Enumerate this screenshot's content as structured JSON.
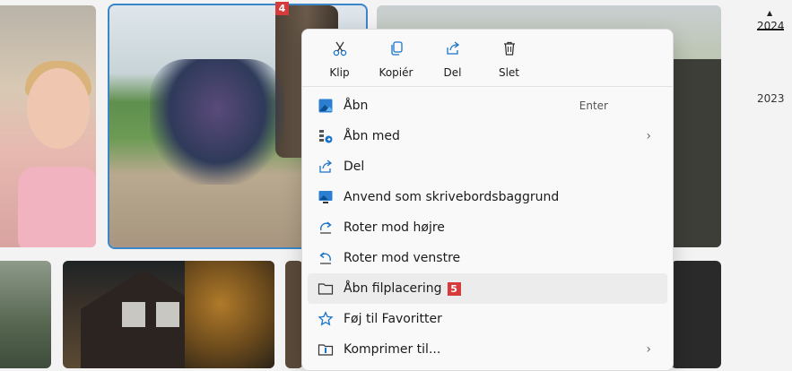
{
  "badges": {
    "photo": "4",
    "menu_item": "5"
  },
  "timeline": {
    "years": [
      "2024",
      "2023"
    ]
  },
  "quick_actions": [
    {
      "label": "Klip",
      "icon": "scissors-icon"
    },
    {
      "label": "Kopiér",
      "icon": "copy-icon"
    },
    {
      "label": "Del",
      "icon": "share-icon"
    },
    {
      "label": "Slet",
      "icon": "trash-icon"
    }
  ],
  "menu_items": [
    {
      "label": "Åbn",
      "icon": "photo-icon",
      "shortcut": "Enter"
    },
    {
      "label": "Åbn med",
      "icon": "open-with-icon",
      "submenu": "›"
    },
    {
      "label": "Del",
      "icon": "share-icon"
    },
    {
      "label": "Anvend som skrivebordsbaggrund",
      "icon": "wallpaper-icon"
    },
    {
      "label": "Roter mod højre",
      "icon": "rotate-right-icon"
    },
    {
      "label": "Roter mod venstre",
      "icon": "rotate-left-icon"
    },
    {
      "label": "Åbn filplacering",
      "icon": "folder-icon",
      "highlighted": true
    },
    {
      "label": "Føj til Favoritter",
      "icon": "star-icon"
    },
    {
      "label": "Komprimer til...",
      "icon": "compress-icon",
      "submenu": "›"
    }
  ],
  "colors": {
    "accent": "#3a86c8",
    "badge": "#d63a3a",
    "icon_blue": "#1a73c8"
  }
}
